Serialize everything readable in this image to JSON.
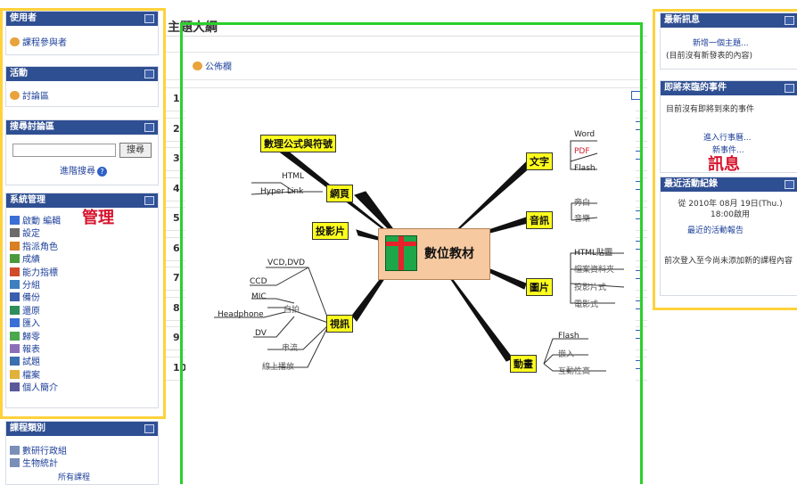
{
  "left": {
    "participants": {
      "title": "使用者",
      "items": [
        {
          "icon": "users-icon",
          "label": "課程參與者"
        }
      ]
    },
    "activities": {
      "title": "活動",
      "items": [
        {
          "icon": "forum-icon",
          "label": "討論區"
        }
      ]
    },
    "search": {
      "title": "搜尋討論區",
      "button": "搜尋",
      "input_value": "",
      "advanced": "進階搜尋"
    },
    "admin": {
      "title": "系統管理",
      "items": [
        {
          "icon": "edit-icon",
          "label": "啟動 編輯"
        },
        {
          "icon": "settings-icon",
          "label": "設定"
        },
        {
          "icon": "roles-icon",
          "label": "指派角色"
        },
        {
          "icon": "grades-icon",
          "label": "成績"
        },
        {
          "icon": "outcomes-icon",
          "label": "能力指標"
        },
        {
          "icon": "groups-icon",
          "label": "分組"
        },
        {
          "icon": "backup-icon",
          "label": "備份"
        },
        {
          "icon": "restore-icon",
          "label": "還原"
        },
        {
          "icon": "import-icon",
          "label": "匯入"
        },
        {
          "icon": "reset-icon",
          "label": "歸零"
        },
        {
          "icon": "reports-icon",
          "label": "報表"
        },
        {
          "icon": "questions-icon",
          "label": "試題"
        },
        {
          "icon": "files-icon",
          "label": "檔案"
        },
        {
          "icon": "profile-icon",
          "label": "個人簡介"
        }
      ]
    },
    "categories": {
      "title": "課程類別",
      "items": [
        {
          "label": "數研行政組"
        },
        {
          "label": "生物統計"
        }
      ],
      "all": "所有課程"
    }
  },
  "center": {
    "title": "主題大綱",
    "news": "公佈欄",
    "rows": [
      "1",
      "2",
      "3",
      "4",
      "5",
      "6",
      "7",
      "8",
      "9",
      "10"
    ]
  },
  "right": {
    "news": {
      "title": "最新訊息",
      "add": "新增一個主題...",
      "none": "(目前沒有新發表的內容)"
    },
    "events": {
      "title": "即將來臨的事件",
      "none": "目前沒有即將到來的事件",
      "goto": "進入行事曆...",
      "new": "新事件..."
    },
    "recent": {
      "title": "最近活動紀錄",
      "since": "從 2010年 08月 19日(Thu.) 18:00啟用",
      "report": "最近的活動報告",
      "none": "前次登入至今尚未添加新的課程內容"
    }
  },
  "annotations": {
    "manage": "管理",
    "message": "訊息"
  },
  "mindmap": {
    "center": "數位教材",
    "branches": {
      "math": "數理公式與符號",
      "web": "網頁",
      "slides": "投影片",
      "video": "視訊",
      "text": "文字",
      "audio": "音訊",
      "image": "圖片",
      "anim": "動畫"
    },
    "leaves": {
      "web_html": "HTML",
      "web_hyper": "Hyper Link",
      "text_word": "Word",
      "text_pdf": "PDF",
      "text_flash": "Flash",
      "audio_narr": "旁白",
      "audio_music": "音樂",
      "img_html": "HTML貼圖",
      "img_file": "檔案資料夾",
      "img_proj": "投影片式",
      "img_movie": "電影式",
      "anim_flash": "Flash",
      "anim_embed": "嵌入",
      "anim_inter": "互動性高",
      "vid_vcd": "VCD,DVD",
      "vid_ccd": "CCD",
      "vid_mic": "MIC",
      "vid_head": "Headphone",
      "vid_dv": "DV",
      "vid_self": "自拍",
      "vid_stream": "串流",
      "vid_online": "線上播放"
    }
  },
  "colors": {
    "header": "#2f4f93",
    "yellow_frame": "#ffd23c",
    "green_frame": "#2bd02b",
    "annotation": "#d6132c",
    "label_bg": "#ffff1e",
    "center_bg": "#f6c9a0"
  }
}
